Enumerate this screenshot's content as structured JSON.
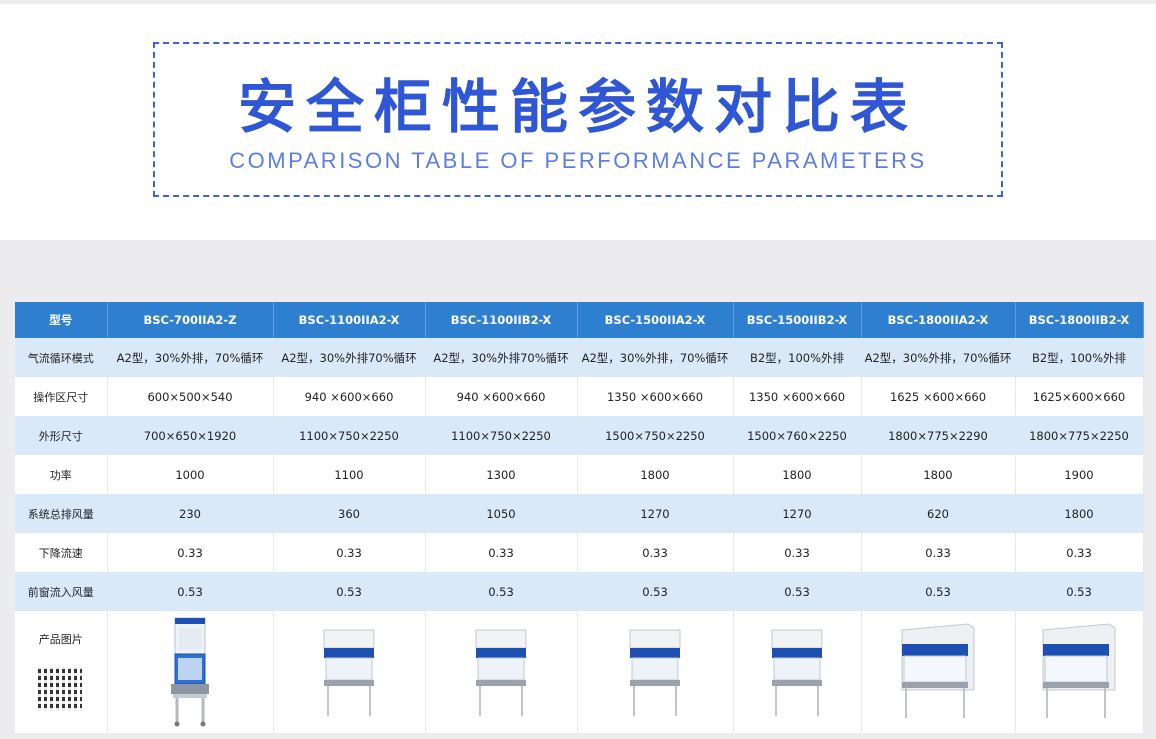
{
  "header": {
    "title_cn": "安全柜性能参数对比表",
    "title_en": "COMPARISON TABLE OF PERFORMANCE PARAMETERS"
  },
  "table": {
    "corner_label": "型号",
    "models": [
      "BSC-700IIA2-Z",
      "BSC-1100IIA2-X",
      "BSC-1100IIB2-X",
      "BSC-1500IIA2-X",
      "BSC-1500IIB2-X",
      "BSC-1800IIA2-X",
      "BSC-1800IIB2-X"
    ],
    "rows": [
      {
        "label": "气流循环模式",
        "values": [
          "A2型，30%外排，70%循环",
          "A2型，30%外排70%循环",
          "A2型，30%外排70%循环",
          "A2型，30%外排，70%循环",
          "B2型，100%外排",
          "A2型，30%外排，70%循环",
          "B2型，100%外排"
        ]
      },
      {
        "label": "操作区尺寸",
        "values": [
          "600×500×540",
          "940 ×600×660",
          "940 ×600×660",
          "1350 ×600×660",
          "1350 ×600×660",
          "1625 ×600×660",
          "1625×600×660"
        ]
      },
      {
        "label": "外形尺寸",
        "values": [
          "700×650×1920",
          "1100×750×2250",
          "1100×750×2250",
          "1500×750×2250",
          "1500×760×2250",
          "1800×775×2290",
          "1800×775×2250"
        ]
      },
      {
        "label": "功率",
        "values": [
          "1000",
          "1100",
          "1300",
          "1800",
          "1800",
          "1800",
          "1900"
        ]
      },
      {
        "label": "系统总排风量",
        "values": [
          "230",
          "360",
          "1050",
          "1270",
          "1270",
          "620",
          "1800"
        ]
      },
      {
        "label": "下降流速",
        "values": [
          "0.33",
          "0.33",
          "0.33",
          "0.33",
          "0.33",
          "0.33",
          "0.33"
        ]
      },
      {
        "label": "前窗流入风量",
        "values": [
          "0.53",
          "0.53",
          "0.53",
          "0.53",
          "0.53",
          "0.53",
          "0.53"
        ]
      }
    ],
    "image_row_label": "产品图片"
  },
  "colors": {
    "title": "#2f56d4",
    "header_bg": "#2e7fd0",
    "row_alt": "#d9e9f8",
    "cabinet_blue": "#1e4fb3"
  }
}
